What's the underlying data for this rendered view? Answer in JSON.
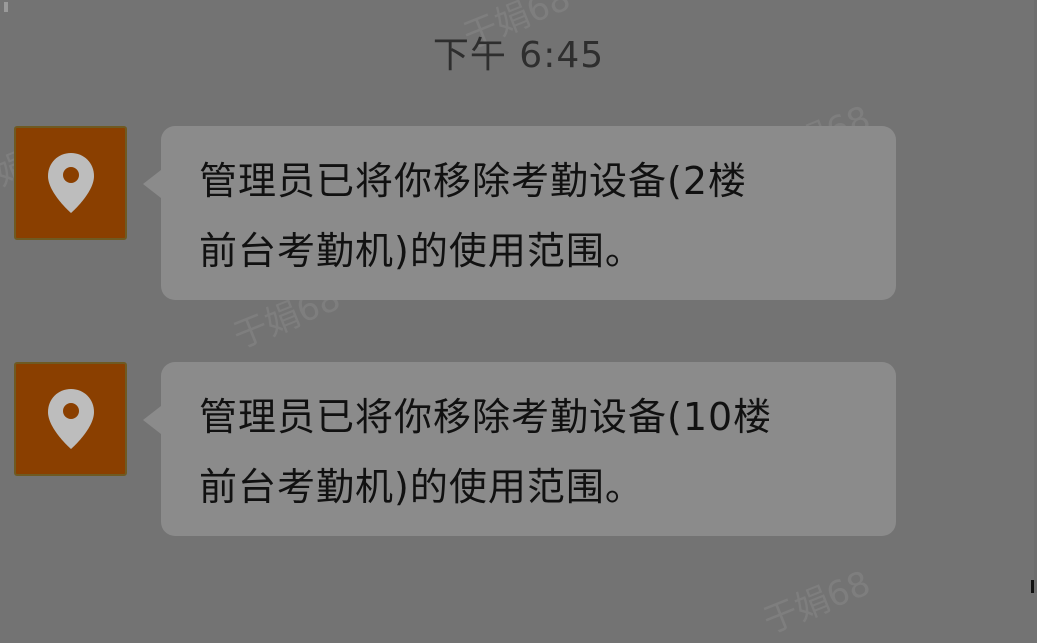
{
  "timestamp": "下午 6:45",
  "watermark_text": "于娟68",
  "messages": [
    {
      "icon": "location-pin-icon",
      "line1": "管理员已将你移除考勤设备(2楼",
      "line2": "前台考勤机)的使用范围。"
    },
    {
      "icon": "location-pin-icon",
      "line1": "管理员已将你移除考勤设备(10楼",
      "line2": "前台考勤机)的使用范围。"
    }
  ],
  "colors": {
    "background": "#737373",
    "bubble": "#8b8b8b",
    "avatar": "#8a3f00",
    "pin": "#bdbdbd"
  }
}
